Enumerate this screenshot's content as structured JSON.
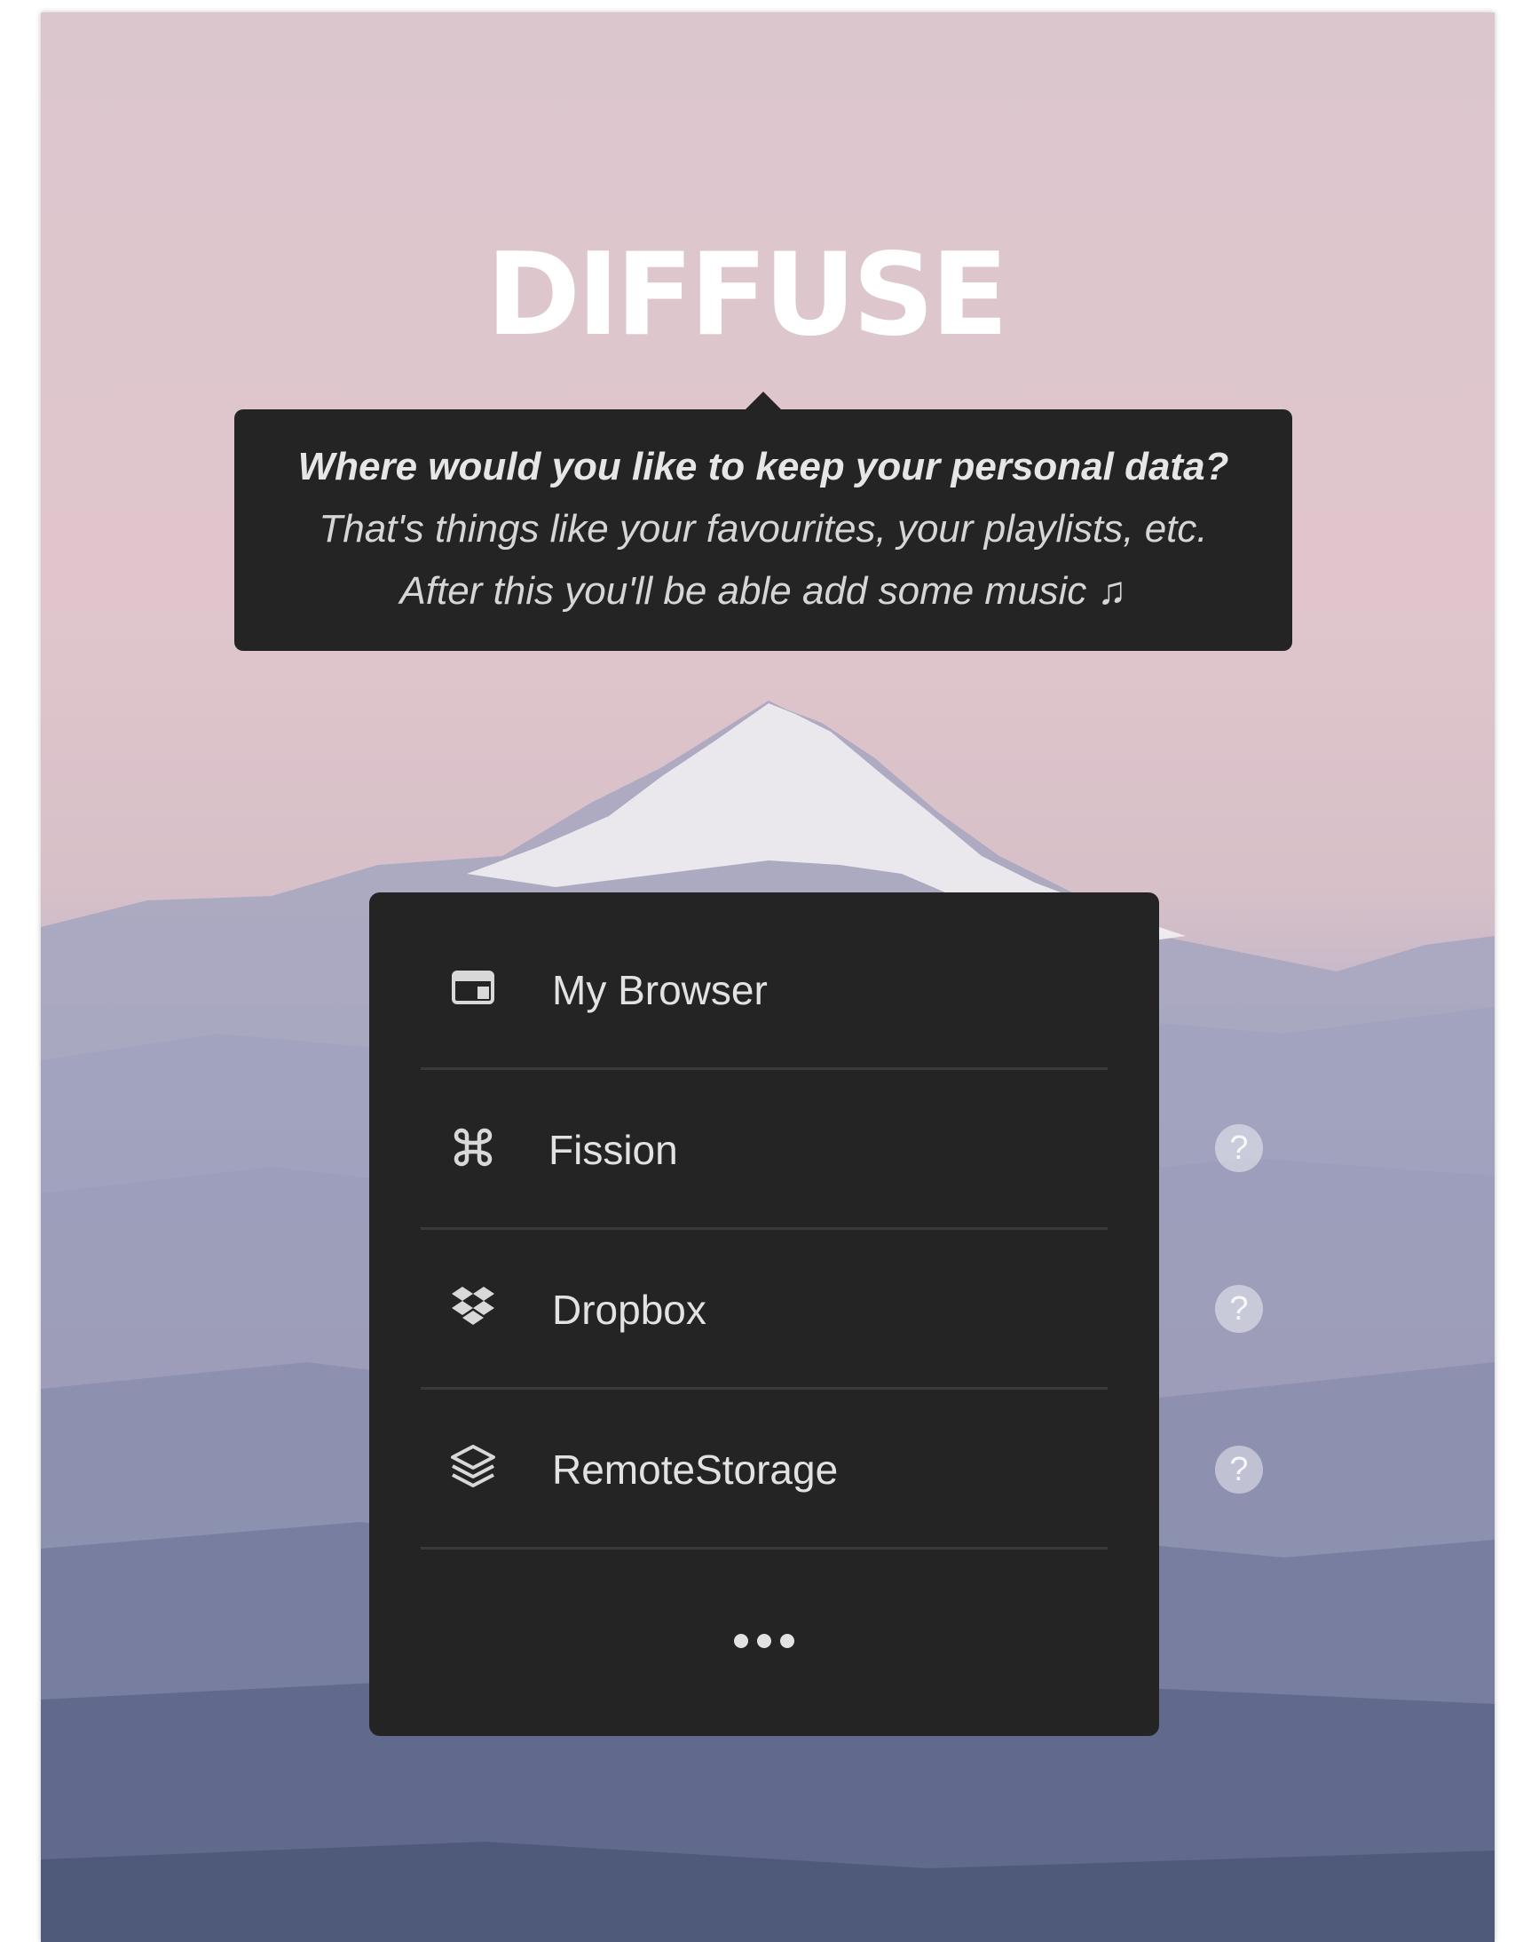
{
  "app": {
    "logo_text": "DIFFUSE"
  },
  "tooltip": {
    "question": "Where would you like to keep your personal data?",
    "line2": "That's things like your favourites, your playlists, etc.",
    "line3": "After this you'll be able add some music ♫"
  },
  "storage_options": [
    {
      "label": "My Browser",
      "icon": "browser-window-icon",
      "has_help": false
    },
    {
      "label": "Fission",
      "icon": "fission-icon",
      "has_help": true
    },
    {
      "label": "Dropbox",
      "icon": "dropbox-icon",
      "has_help": true
    },
    {
      "label": "RemoteStorage",
      "icon": "layers-icon",
      "has_help": true
    }
  ],
  "help_label": "?",
  "more_icon": "ellipsis-icon",
  "colors": {
    "panel": "#242424",
    "text": "#e2e2e2",
    "sky": "#e0c6cc",
    "mountains": "#6f7897"
  }
}
